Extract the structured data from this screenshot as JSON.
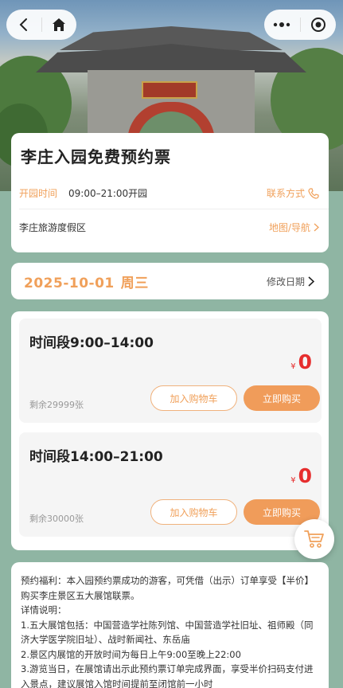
{
  "nav": {
    "back_icon": "back-arrow-icon",
    "home_icon": "home-icon",
    "more_icon": "more-dots-icon",
    "close_icon": "target-close-icon"
  },
  "hero": {
    "plaque_text": "莊 李"
  },
  "info": {
    "title": "李庄入园免费预约票",
    "hours_label": "开园时间",
    "hours_value": "09:00–21:00开园",
    "contact_label": "联系方式",
    "location": "李庄旅游度假区",
    "map_label": "地图/导航"
  },
  "date": {
    "value": "2025-10-01",
    "weekday": "周三",
    "change_label": "修改日期"
  },
  "slots": [
    {
      "title": "时间段9:00–14:00",
      "currency": "¥",
      "price": "0",
      "remaining": "剩余29999张",
      "add_cart": "加入购物车",
      "buy_now": "立即购买"
    },
    {
      "title": "时间段14:00–21:00",
      "currency": "¥",
      "price": "0",
      "remaining": "剩余30000张",
      "add_cart": "加入购物车",
      "buy_now": "立即购买"
    }
  ],
  "notes": {
    "line1": "预约福利：本入园预约票成功的游客，可凭借（出示）订单享受【半价】购买李庄景区五大展馆联票。",
    "line2": "详情说明：",
    "line3": "1.五大展馆包括：中国营造学社陈列馆、中国营造学社旧址、祖师殿（同济大学医学院旧址）、战时新闻社、东岳庙",
    "line4": "2.景区内展馆的开放时间为每日上午9:00至晚上22:00",
    "line5": "3.游览当日，在展馆请出示此预约票订单完成界面，享受半价扫码支付进入景点，建议展馆入馆时间提前至闭馆前一小时"
  },
  "colors": {
    "accent": "#f0a05a",
    "price": "#e62e2e",
    "background": "#8fb5a3"
  }
}
